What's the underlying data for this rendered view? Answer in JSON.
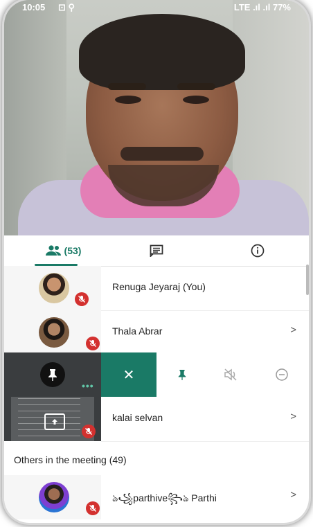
{
  "status_bar": {
    "time": "10:05",
    "icons": "⊡ ⚲",
    "right": "LTE .ıl .ıl 77%"
  },
  "tabs": {
    "people_count": "(53)",
    "chat_icon": "chat-icon",
    "info_icon": "info-icon"
  },
  "participants": [
    {
      "name": "Renuga Jeyaraj (You)",
      "muted": true
    },
    {
      "name": "Thala Abrar",
      "muted": true
    },
    {
      "name": "kalai selvan",
      "muted": true
    }
  ],
  "actions": [
    "close",
    "pin",
    "mute",
    "remove"
  ],
  "others_section": "Others in the meeting (49)",
  "others": [
    {
      "name": "ঌ꧁parthive꧂ঌ Parthi",
      "muted": true
    }
  ],
  "colors": {
    "accent": "#1a7a66",
    "mute_red": "#d3312f"
  }
}
